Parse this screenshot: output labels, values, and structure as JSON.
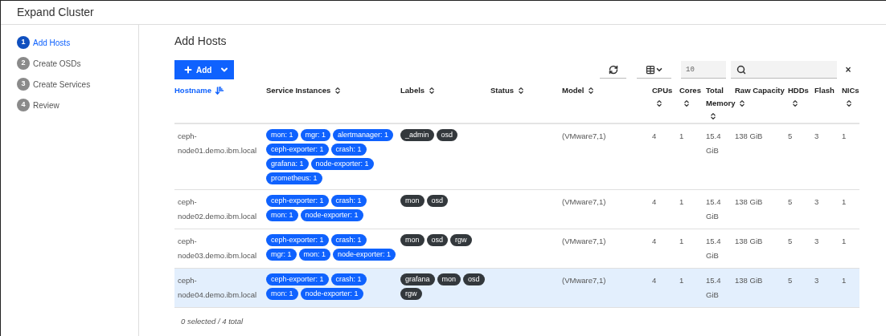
{
  "window": {
    "title": "Expand Cluster"
  },
  "steps": [
    {
      "number": "1",
      "label": "Add Hosts",
      "selected": true
    },
    {
      "number": "2",
      "label": "Create OSDs",
      "selected": false
    },
    {
      "number": "3",
      "label": "Create Services",
      "selected": false
    },
    {
      "number": "4",
      "label": "Review",
      "selected": false
    }
  ],
  "heading": "Add Hosts",
  "toolbar": {
    "add_button": "Add",
    "page_size": "10",
    "search": {
      "clear": "×"
    }
  },
  "table": {
    "columns": [
      {
        "label": "Hostname",
        "sortable": true,
        "sorted": true
      },
      {
        "label": "Service Instances",
        "sortable": true,
        "sorted": false
      },
      {
        "label": "Labels",
        "sortable": true,
        "sorted": false
      },
      {
        "label": "Status",
        "sortable": true,
        "sorted": false
      },
      {
        "label": "Model",
        "sortable": true,
        "sorted": false
      },
      {
        "label": "CPUs",
        "sortable": true,
        "sorted": false
      },
      {
        "label": "Cores",
        "sortable": true,
        "sorted": false
      },
      {
        "label": "Total Memory",
        "sortable": true,
        "sorted": false
      },
      {
        "label": "Raw Capacity",
        "sortable": true,
        "sorted": false
      },
      {
        "label": "HDDs",
        "sortable": true,
        "sorted": false
      },
      {
        "label": "Flash",
        "sortable": false,
        "sorted": false
      },
      {
        "label": "NICs",
        "sortable": true,
        "sorted": false
      }
    ],
    "rows": [
      {
        "selected": false,
        "hostname": "ceph-node01.demo.ibm.local",
        "services": [
          "mon: 1",
          "mgr: 1",
          "alertmanager: 1",
          "ceph-exporter: 1",
          "crash: 1",
          "grafana: 1",
          "node-exporter: 1",
          "prometheus: 1"
        ],
        "labels": [
          "_admin",
          "osd"
        ],
        "model": "(VMware7,1)",
        "cpus": "4",
        "cores": "1",
        "memory": "15.4 GiB",
        "capacity": "138 GiB",
        "hdds": "5",
        "flash": "3",
        "nics": "1"
      },
      {
        "selected": false,
        "hostname": "ceph-node02.demo.ibm.local",
        "services": [
          "ceph-exporter: 1",
          "crash: 1",
          "mon: 1",
          "node-exporter: 1"
        ],
        "labels": [
          "mon",
          "osd"
        ],
        "model": "(VMware7,1)",
        "cpus": "4",
        "cores": "1",
        "memory": "15.4 GiB",
        "capacity": "138 GiB",
        "hdds": "5",
        "flash": "3",
        "nics": "1"
      },
      {
        "selected": false,
        "hostname": "ceph-node03.demo.ibm.local",
        "services": [
          "ceph-exporter: 1",
          "crash: 1",
          "mgr: 1",
          "mon: 1",
          "node-exporter: 1"
        ],
        "labels": [
          "mon",
          "osd",
          "rgw"
        ],
        "model": "(VMware7,1)",
        "cpus": "4",
        "cores": "1",
        "memory": "15.4 GiB",
        "capacity": "138 GiB",
        "hdds": "5",
        "flash": "3",
        "nics": "1"
      },
      {
        "selected": true,
        "hostname": "ceph-node04.demo.ibm.local",
        "services": [
          "ceph-exporter: 1",
          "crash: 1",
          "mon: 1",
          "node-exporter: 1"
        ],
        "labels": [
          "grafana",
          "mon",
          "osd",
          "rgw"
        ],
        "model": "(VMware7,1)",
        "cpus": "4",
        "cores": "1",
        "memory": "15.4 GiB",
        "capacity": "138 GiB",
        "hdds": "5",
        "flash": "3",
        "nics": "1"
      }
    ]
  },
  "footer": "0 selected / 4 total"
}
